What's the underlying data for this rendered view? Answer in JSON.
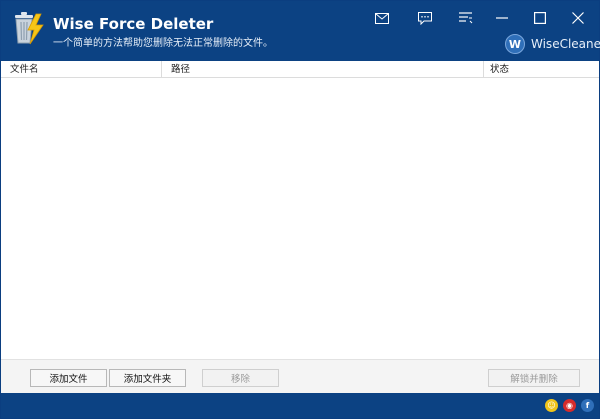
{
  "app": {
    "title": "Wise Force Deleter",
    "subtitle": "一个简单的方法帮助您删除无法正常删除的文件。",
    "brand_name": "WiseCleaner",
    "brand_initial": "W"
  },
  "titlebar_buttons": [
    "mail-icon",
    "chat-icon",
    "menu-icon",
    "minimize-icon",
    "maximize-icon",
    "close-icon"
  ],
  "table": {
    "columns": [
      "文件名",
      "路径",
      "状态"
    ],
    "rows": []
  },
  "buttons": {
    "add_file": "添加文件",
    "add_folder": "添加文件夹",
    "remove": "移除",
    "unlock_delete": "解锁并删除"
  },
  "colors": {
    "titlebar": "#0c4283",
    "statusbar": "#0c4283"
  }
}
